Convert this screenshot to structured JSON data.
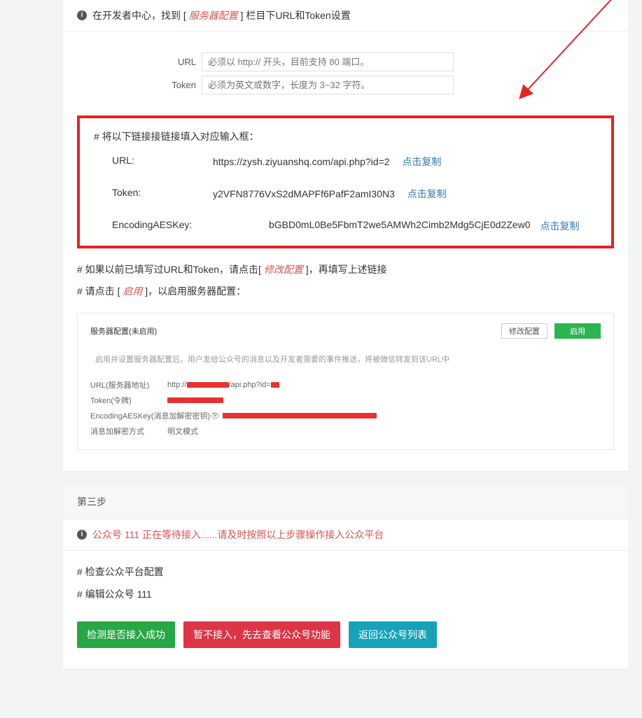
{
  "card1": {
    "alert": {
      "prefix": "在开发者中心，找到 [ ",
      "server_config": "服务器配置",
      "suffix": " ] 栏目下URL和Token设置"
    },
    "form": {
      "url_label": "URL",
      "url_placeholder": "必须以 http:// 开头，目前支持 80 端口。",
      "token_label": "Token",
      "token_placeholder": "必须为英文或数字，长度为 3~32 字符。"
    },
    "redbox": {
      "title": "# 将以下链接接链接填入对应输入框：",
      "rows": {
        "url": {
          "label": "URL:",
          "value": "https://zysh.ziyuanshq.com/api.php?id=2",
          "copy": "点击复制"
        },
        "token": {
          "label": "Token:",
          "value": "y2VFN8776VxS2dMAPFf6PafF2amI30N3",
          "copy": "点击复制"
        },
        "aes": {
          "label": "EncodingAESKey:",
          "value": "bGBD0mL0Be5FbmT2we5AMWh2Cimb2Mdg5CjE0d2Zew0",
          "copy": "点击复制"
        }
      }
    },
    "notes": {
      "line1_prefix": "# 如果以前已填写过URL和Token，请点击[ ",
      "line1_action": "修改配置",
      "line1_suffix": " ]，再填写上述链接",
      "line2_prefix": "# 请点击 [ ",
      "line2_action": "启用",
      "line2_suffix": " ]，以启用服务器配置："
    },
    "embed": {
      "header_left": "服务器配置(未启用)",
      "btn_modify": "修改配置",
      "btn_enable": "启用",
      "desc": "启用并设置服务器配置后，用户发给公众号的消息以及开发者需要的事件推送，将被微信转发到该URL中",
      "rows": {
        "url": {
          "label": "URL(服务器地址)",
          "prefix": "http://",
          "suffix": "/api.php?id="
        },
        "token": {
          "label": "Token(令牌)"
        },
        "aes": {
          "label": "EncodingAESKey(消息加解密密钥)"
        },
        "mode": {
          "label": "消息加解密方式",
          "value": "明文模式"
        }
      }
    }
  },
  "card2": {
    "header": "第三步",
    "alert": "公众号 111 正在等待接入......请及时按照以上步骤操作接入公众平台",
    "hash1": "# 检查公众平台配置",
    "hash2": "# 编辑公众号 111",
    "btn_detect": "检测是否接入成功",
    "btn_skip": "暂不接入，先去查看公众号功能",
    "btn_back": "返回公众号列表"
  }
}
